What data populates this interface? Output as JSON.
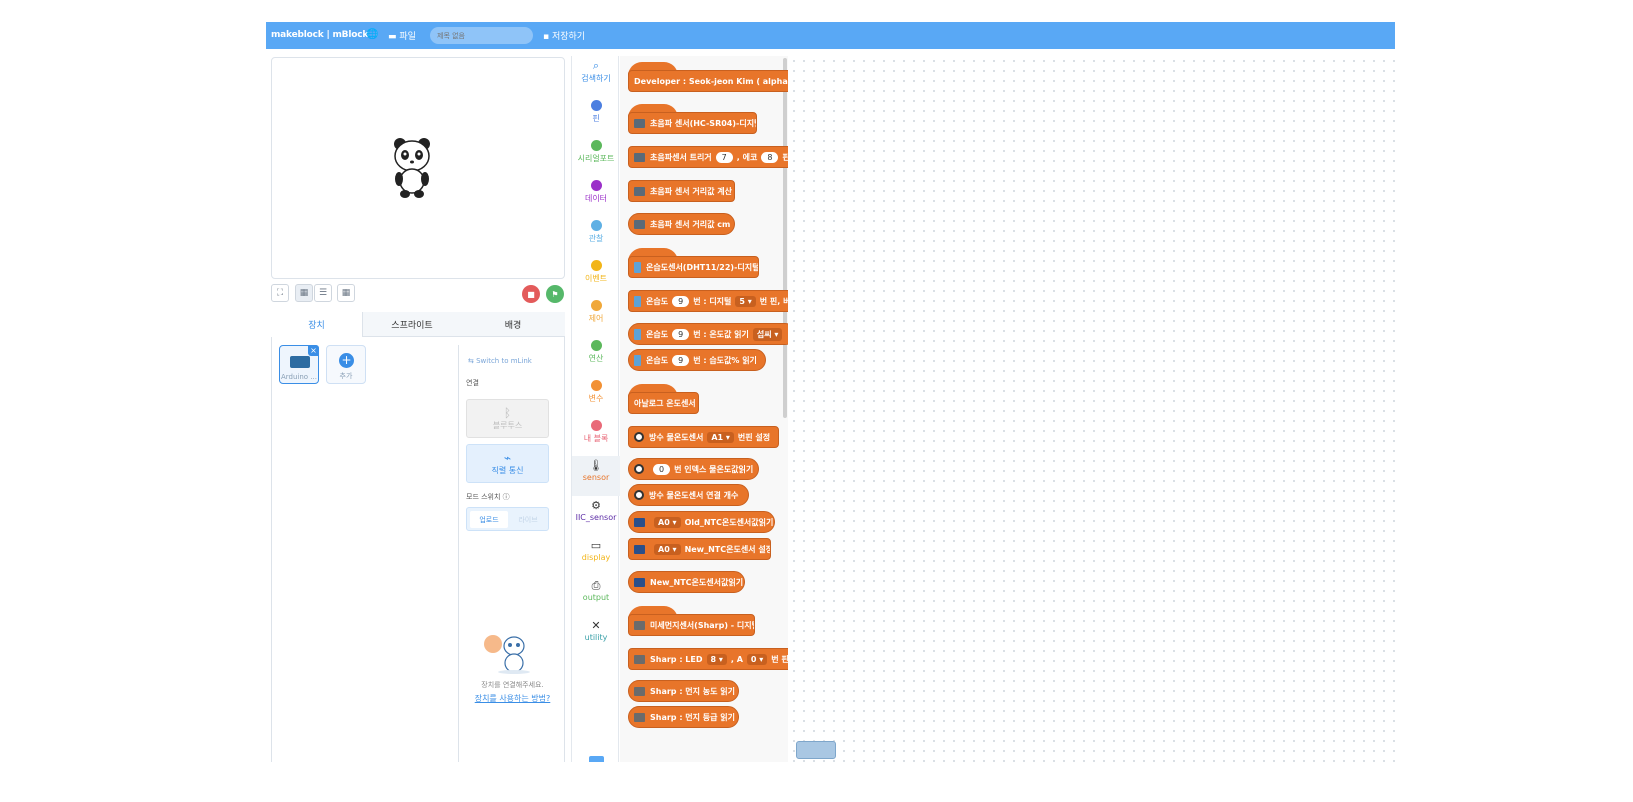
{
  "topbar": {
    "logo": "makeblock | mBlock",
    "globe_icon": "globe-icon",
    "file_label": "파일",
    "title_placeholder": "제목 없음",
    "save_label": "저장하기"
  },
  "stage": {
    "sprite_icon": "panda-sprite"
  },
  "tabs": {
    "device": "장치",
    "sprite": "스프라이트",
    "background": "배경"
  },
  "devices": {
    "arduino_label": "Arduino ...",
    "add_label": "추가"
  },
  "connection": {
    "switch_link": "⇆ Switch to mLink",
    "section_label": "연결",
    "bluetooth_label": "블루투스",
    "serial_label": "직렬 통신",
    "mode_label": "모드 스위치",
    "upload_label": "업로드",
    "live_label": "라이브",
    "help_text": "장치를 연결해주세요.",
    "help_link": "장치를 사용하는 방법?"
  },
  "categories": [
    {
      "label": "검색하기",
      "color": "#3a8ee6",
      "icon": "search-icon"
    },
    {
      "label": "핀",
      "color": "#4c7fe0"
    },
    {
      "label": "시리얼포트",
      "color": "#5cb85c"
    },
    {
      "label": "데이터",
      "color": "#9b30c9"
    },
    {
      "label": "관찰",
      "color": "#5fb0e4"
    },
    {
      "label": "이벤트",
      "color": "#f2b519"
    },
    {
      "label": "제어",
      "color": "#f0a83a"
    },
    {
      "label": "연산",
      "color": "#5cb85c"
    },
    {
      "label": "변수",
      "color": "#f29135"
    },
    {
      "label": "내 블록",
      "color": "#e96a79"
    },
    {
      "label": "sensor",
      "color": "#e8752a",
      "icon": "thermometer-icon"
    },
    {
      "label": "IIC_sensor",
      "color": "#5c2ca6",
      "icon": "gear-icon"
    },
    {
      "label": "display",
      "color": "#f2b519",
      "icon": "monitor-icon"
    },
    {
      "label": "output",
      "color": "#5cb85c",
      "icon": "printer-icon"
    },
    {
      "label": "utility",
      "color": "#3aa0a8",
      "icon": "tools-icon"
    }
  ],
  "blocks": {
    "b0": "Developer : Seok-jeon Kim ( alphaco@kakao.",
    "b1": "초음파 센서(HC-SR04)-디지털",
    "b2a": "초음파센서 트리거",
    "b2v1": "7",
    "b2b": ", 에코",
    "b2v2": "8",
    "b2c": "핀 설",
    "b3": "초음파 센서 거리값 계산",
    "b4": "초음파 센서 거리값 cm",
    "b5": "온습도센서(DHT11/22)-디지털",
    "b6a": "온습도",
    "b6v1": "9",
    "b6b": "번 : 디지털",
    "b6d": "5 ▾",
    "b6c": "번 핀, 버",
    "b7a": "온습도",
    "b7v1": "9",
    "b7b": "번 : 온도값 읽기",
    "b7d": "섭씨 ▾",
    "b8a": "온습도",
    "b8v1": "9",
    "b8b": "번 : 습도값% 읽기",
    "b9": "아날로그 온도센서",
    "b10a": "방수 물온도센서",
    "b10d": "A1 ▾",
    "b10b": "번핀 설정",
    "b11v": "0",
    "b11a": "번 인덱스 물온도값읽기",
    "b12": "방수 물온도센서 연결 개수",
    "b13d": "A0 ▾",
    "b13a": "Old_NTC온도센서값읽기",
    "b14d": "A0 ▾",
    "b14a": "New_NTC온도센서 설정",
    "b15": "New_NTC온도센서값읽기",
    "b16": "미세먼지센서(Sharp) - 디지털",
    "b17a": "Sharp : LED",
    "b17d1": "8 ▾",
    "b17b": ", A",
    "b17d2": "0 ▾",
    "b17c": "번 핀으로",
    "b18": "Sharp : 먼지 농도 읽기",
    "b19": "Sharp : 먼지 등급 읽기"
  },
  "colors": {
    "accent": "#59a8f5",
    "block": "#e8752a"
  }
}
